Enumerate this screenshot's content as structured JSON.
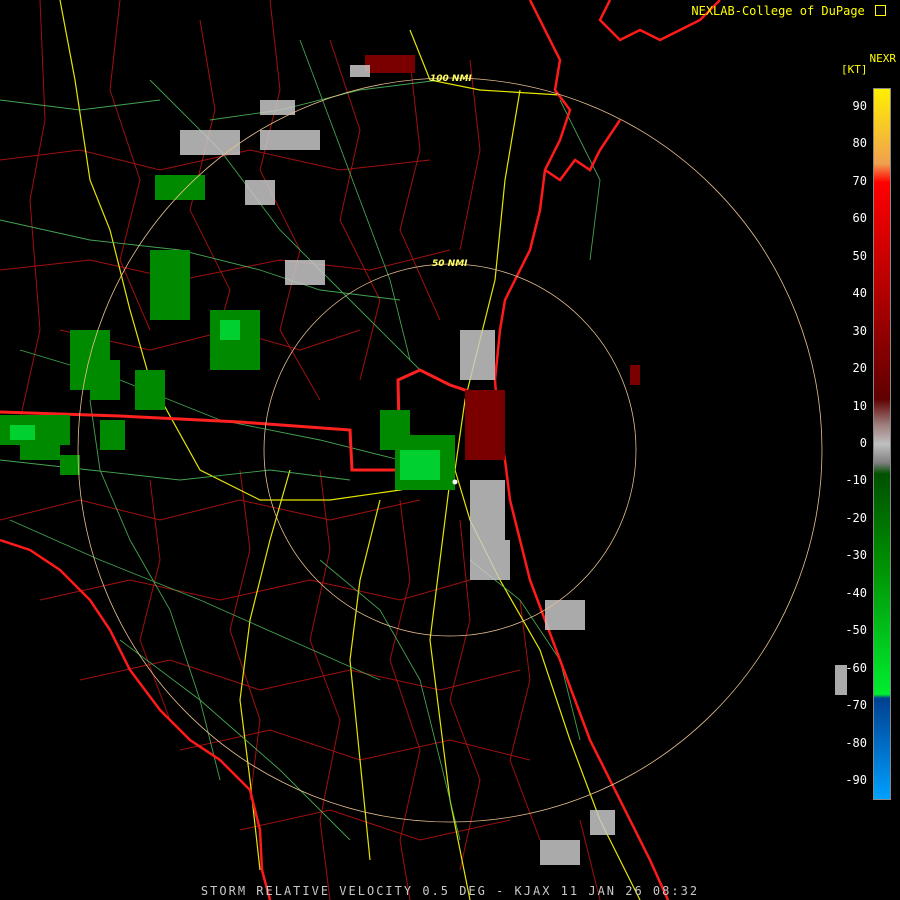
{
  "header": {
    "credit": "NEXLAB-College of DuPage",
    "credit_icon": "external-link-icon"
  },
  "legend": {
    "product": "NEXR",
    "unit": "[KT]",
    "ticks": [
      "90",
      "80",
      "70",
      "60",
      "50",
      "40",
      "30",
      "20",
      "10",
      "0",
      "-10",
      "-20",
      "-30",
      "-40",
      "-50",
      "-60",
      "-70",
      "-80",
      "-90"
    ],
    "color_stops": [
      {
        "value": 95,
        "color": "#fff000"
      },
      {
        "value": 75,
        "color": "#f0a050"
      },
      {
        "value": 70,
        "color": "#ff0000"
      },
      {
        "value": 40,
        "color": "#b00000"
      },
      {
        "value": 12,
        "color": "#600000"
      },
      {
        "value": 5,
        "color": "#a08080"
      },
      {
        "value": 0,
        "color": "#c0c0c0"
      },
      {
        "value": -5,
        "color": "#808080"
      },
      {
        "value": -8,
        "color": "#005000"
      },
      {
        "value": -30,
        "color": "#008a00"
      },
      {
        "value": -67,
        "color": "#00ee30"
      },
      {
        "value": -68,
        "color": "#004090"
      },
      {
        "value": -95,
        "color": "#00a0ff"
      }
    ]
  },
  "range_rings": {
    "inner_label": "50 NMI",
    "outer_label": "100 NMI"
  },
  "footer": {
    "caption": "STORM RELATIVE VELOCITY 0.5 DEG - KJAX 11 JAN 26 08:32"
  }
}
